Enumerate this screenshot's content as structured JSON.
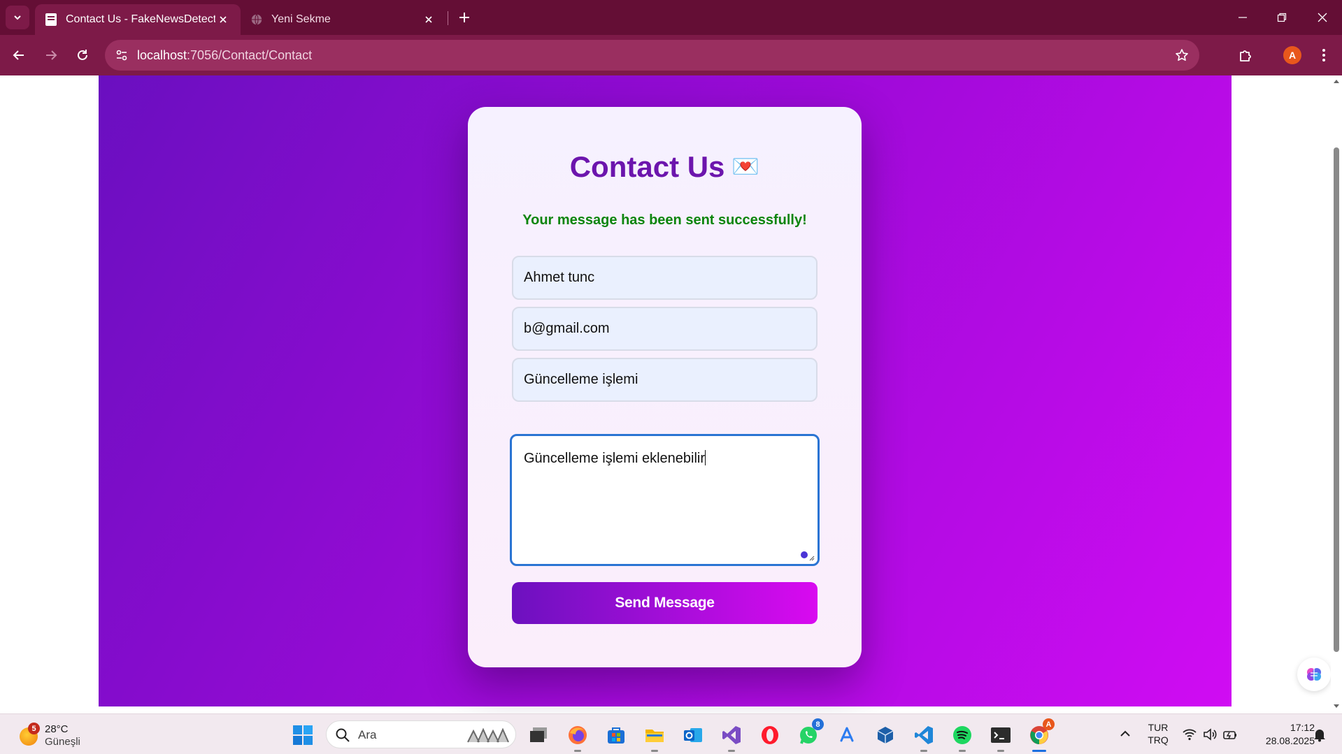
{
  "browser": {
    "tabs": [
      {
        "title": "Contact Us - FakeNewsDetection",
        "active": true
      },
      {
        "title": "Yeni Sekme",
        "active": false
      }
    ],
    "url_host": "localhost",
    "url_path": ":7056/Contact/Contact",
    "profile_initial": "A",
    "theme_color": "#7d1a48"
  },
  "page": {
    "title": "Contact Us",
    "title_emoji": "💌",
    "success_message": "Your message has been sent successfully!",
    "form": {
      "name_value": "Ahmet tunc",
      "email_value": "b@gmail.com",
      "subject_value": "Güncelleme işlemi",
      "message_value": "Güncelleme işlemi eklenebilir",
      "submit_label": "Send Message"
    },
    "gradient_colors": [
      "#6a0fc0",
      "#d00cf3"
    ]
  },
  "taskbar": {
    "weather": {
      "temp": "28°C",
      "condition": "Güneşli",
      "badge": "5"
    },
    "search_placeholder": "Ara",
    "apps": [
      {
        "name": "task-view"
      },
      {
        "name": "firefox"
      },
      {
        "name": "microsoft-store"
      },
      {
        "name": "file-explorer"
      },
      {
        "name": "outlook"
      },
      {
        "name": "visual-studio"
      },
      {
        "name": "opera"
      },
      {
        "name": "whatsapp",
        "badge": "8"
      },
      {
        "name": "app-store"
      },
      {
        "name": "virtualbox"
      },
      {
        "name": "vs-code"
      },
      {
        "name": "spotify"
      },
      {
        "name": "terminal"
      },
      {
        "name": "chrome",
        "badge": "A"
      }
    ],
    "lang_line1": "TUR",
    "lang_line2": "TRQ",
    "time": "17:12",
    "date": "28.08.2025"
  }
}
